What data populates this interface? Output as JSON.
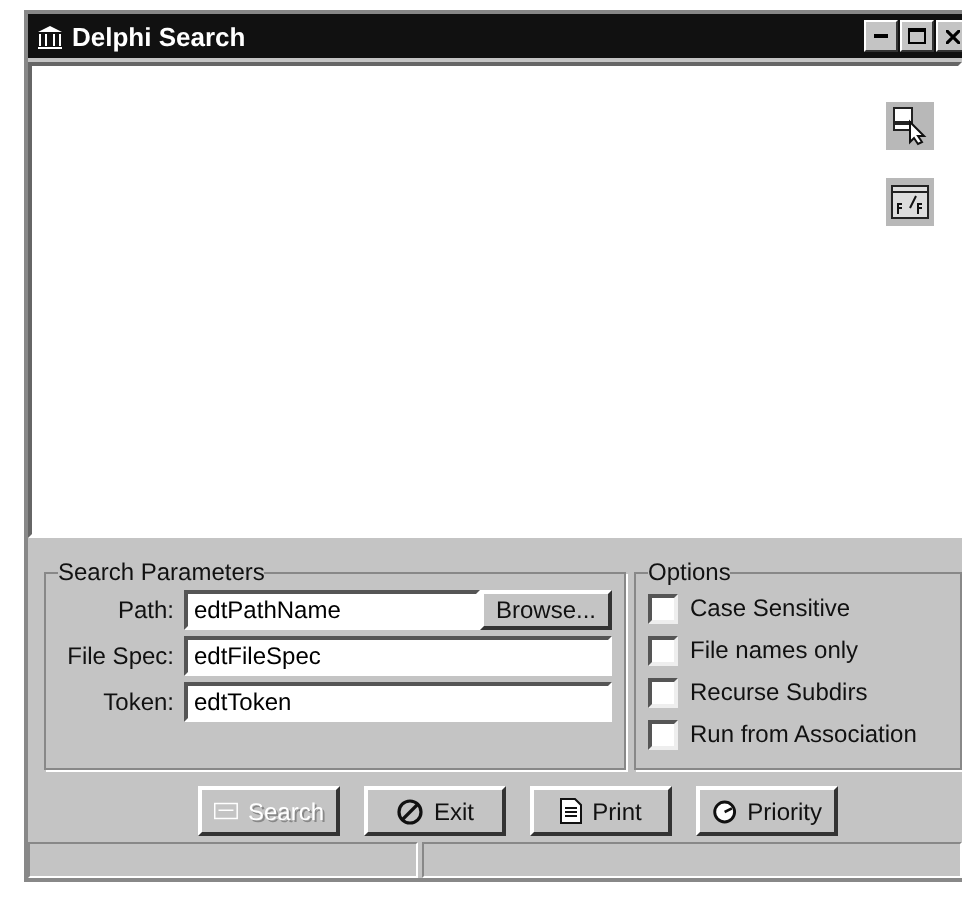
{
  "window": {
    "title": "Delphi Search"
  },
  "tool_buttons": [
    {
      "kind": "pointer"
    },
    {
      "kind": "formula"
    }
  ],
  "search_parameters": {
    "title": "Search Parameters",
    "fields": [
      {
        "label": "Path:",
        "value": "edtPathName",
        "button": {
          "label": "Browse..."
        }
      },
      {
        "label": "File Spec:",
        "value": "edtFileSpec"
      },
      {
        "label": "Token:",
        "value": "edtToken"
      }
    ]
  },
  "options": {
    "title": "Options",
    "items": [
      {
        "label": "Case Sensitive",
        "checked": false
      },
      {
        "label": "File names only",
        "checked": false
      },
      {
        "label": "Recurse Subdirs",
        "checked": false
      },
      {
        "label": "Run from Association",
        "checked": false
      }
    ]
  },
  "buttons": [
    {
      "label": "Search",
      "kind": "search",
      "disabled": true
    },
    {
      "label": "Exit",
      "kind": "exit",
      "disabled": false
    },
    {
      "label": "Print",
      "kind": "print",
      "disabled": false
    },
    {
      "label": "Priority",
      "kind": "priority",
      "disabled": false
    }
  ]
}
